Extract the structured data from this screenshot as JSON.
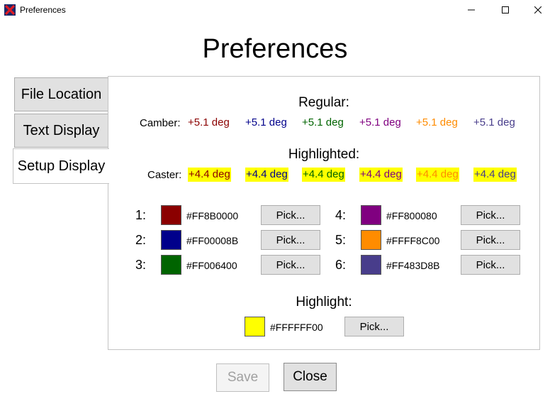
{
  "window": {
    "title": "Preferences",
    "app_icon": "red-x-logo-icon"
  },
  "page_title": "Preferences",
  "tabs": [
    {
      "label": "File Location"
    },
    {
      "label": "Text Display"
    },
    {
      "label": "Setup Display",
      "active": true
    }
  ],
  "setup_display": {
    "regular_heading": "Regular:",
    "camber": {
      "label": "Camber:",
      "values": [
        {
          "text": "+5.1 deg",
          "color": "#8B0000"
        },
        {
          "text": "+5.1 deg",
          "color": "#00008B"
        },
        {
          "text": "+5.1 deg",
          "color": "#006400"
        },
        {
          "text": "+5.1 deg",
          "color": "#800080"
        },
        {
          "text": "+5.1 deg",
          "color": "#FF8C00"
        },
        {
          "text": "+5.1 deg",
          "color": "#483D8B"
        }
      ]
    },
    "highlighted_heading": "Highlighted:",
    "caster": {
      "label": "Caster:",
      "highlight_bg": "#FFFF00",
      "values": [
        {
          "text": "+4.4 deg",
          "color": "#8B0000"
        },
        {
          "text": "+4.4 deg",
          "color": "#00008B"
        },
        {
          "text": "+4.4 deg",
          "color": "#006400"
        },
        {
          "text": "+4.4 deg",
          "color": "#800080"
        },
        {
          "text": "+4.4 deg",
          "color": "#FF8C00"
        },
        {
          "text": "+4.4 deg",
          "color": "#483D8B"
        }
      ]
    },
    "colors": [
      {
        "num": "1:",
        "hex": "#FF8B0000",
        "swatch": "#8B0000",
        "button": "Pick..."
      },
      {
        "num": "2:",
        "hex": "#FF00008B",
        "swatch": "#00008B",
        "button": "Pick..."
      },
      {
        "num": "3:",
        "hex": "#FF006400",
        "swatch": "#006400",
        "button": "Pick..."
      },
      {
        "num": "4:",
        "hex": "#FF800080",
        "swatch": "#800080",
        "button": "Pick..."
      },
      {
        "num": "5:",
        "hex": "#FFFF8C00",
        "swatch": "#FF8C00",
        "button": "Pick..."
      },
      {
        "num": "6:",
        "hex": "#FF483D8B",
        "swatch": "#483D8B",
        "button": "Pick..."
      }
    ],
    "highlight": {
      "heading": "Highlight:",
      "hex": "#FFFFFF00",
      "swatch": "#FFFF00",
      "button": "Pick..."
    }
  },
  "buttons": {
    "save": "Save",
    "close": "Close"
  }
}
